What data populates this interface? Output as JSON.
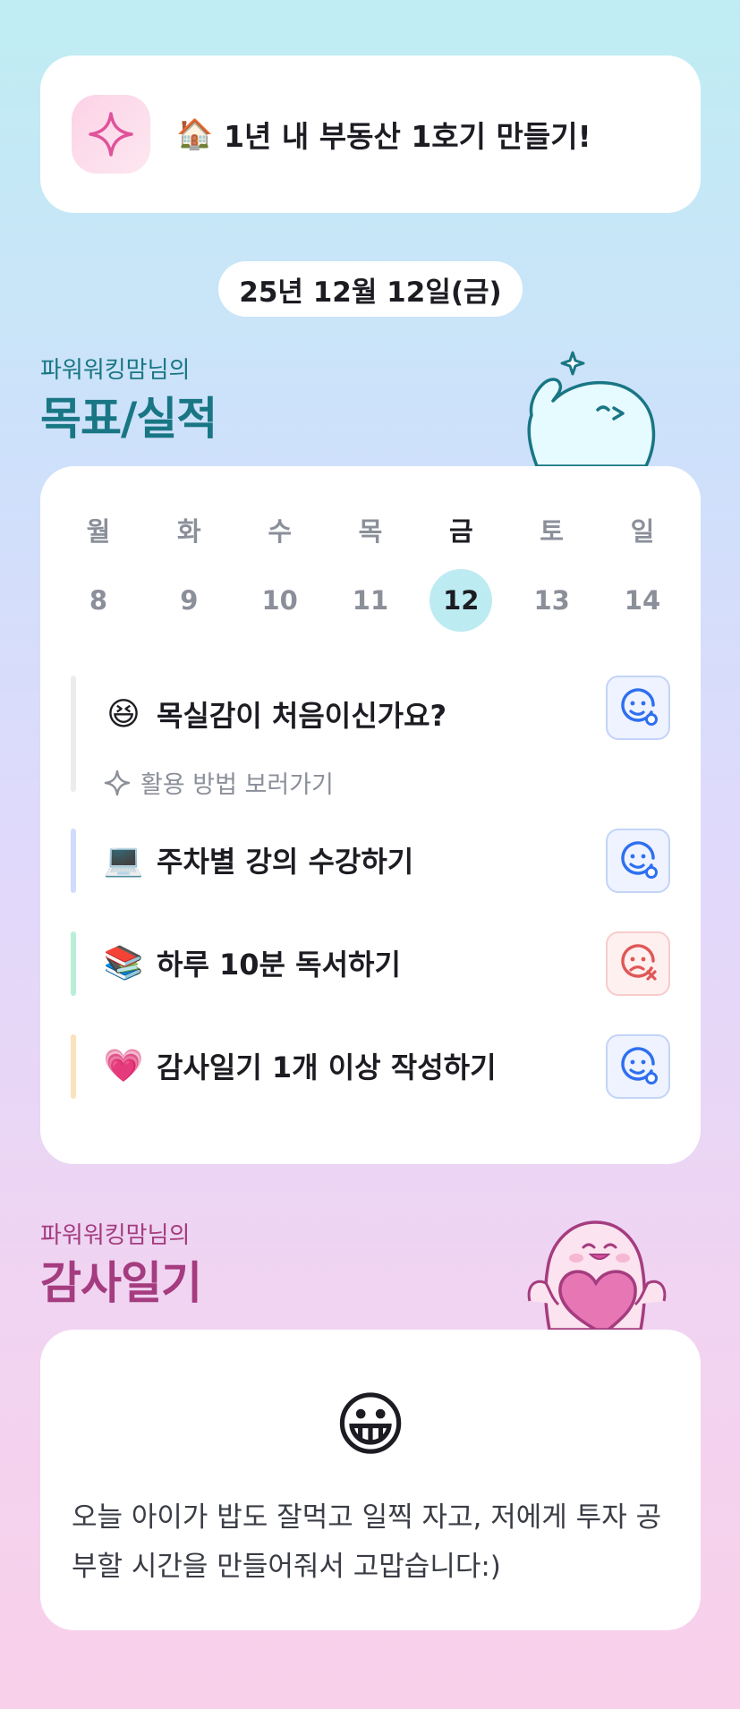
{
  "goal_banner": {
    "icon": "sparkle-icon",
    "emoji": "🏠",
    "text": "1년 내 부동산 1호기 만들기!"
  },
  "date_pill": "25년 12월 12일(금)",
  "goals_section": {
    "subtitle": "파워워킹맘님의",
    "title": "목표/실적"
  },
  "calendar": {
    "weekdays": [
      "월",
      "화",
      "수",
      "목",
      "금",
      "토",
      "일"
    ],
    "days": [
      "8",
      "9",
      "10",
      "11",
      "12",
      "13",
      "14"
    ],
    "selected_index": 4
  },
  "goal_items": [
    {
      "emoji": "😆",
      "label": "목실감이 처음이신가요?",
      "bar_color": "#ececef",
      "status": "done",
      "status_icon": "smile-check-icon",
      "sub_icon": "sparkle-icon",
      "sub_label": "활용 방법 보러가기"
    },
    {
      "emoji": "💻",
      "label": "주차별 강의 수강하기",
      "bar_color": "#cfdcfb",
      "status": "done",
      "status_icon": "smile-check-icon"
    },
    {
      "emoji": "📚",
      "label": "하루 10분 독서하기",
      "bar_color": "#b9efd7",
      "status": "missed",
      "status_icon": "sad-x-icon"
    },
    {
      "emoji": "💗",
      "label": "감사일기 1개 이상 작성하기",
      "bar_color": "#fbe2bd",
      "status": "done",
      "status_icon": "smile-check-icon"
    }
  ],
  "thanks_section": {
    "subtitle": "파워워킹맘님의",
    "title": "감사일기"
  },
  "thanks_entry": {
    "emoji": "😀",
    "text": "오늘 아이가 밥도 잘먹고 일찍 자고, 저에게 투자 공부할 시간을 만들어줘서 고맙습니다:)"
  },
  "colors": {
    "accent_teal": "#197684",
    "accent_pink": "#a53c7f",
    "status_blue": "#2f6ff0",
    "status_red": "#e05757",
    "selected_day_bg": "#bdebf2"
  }
}
